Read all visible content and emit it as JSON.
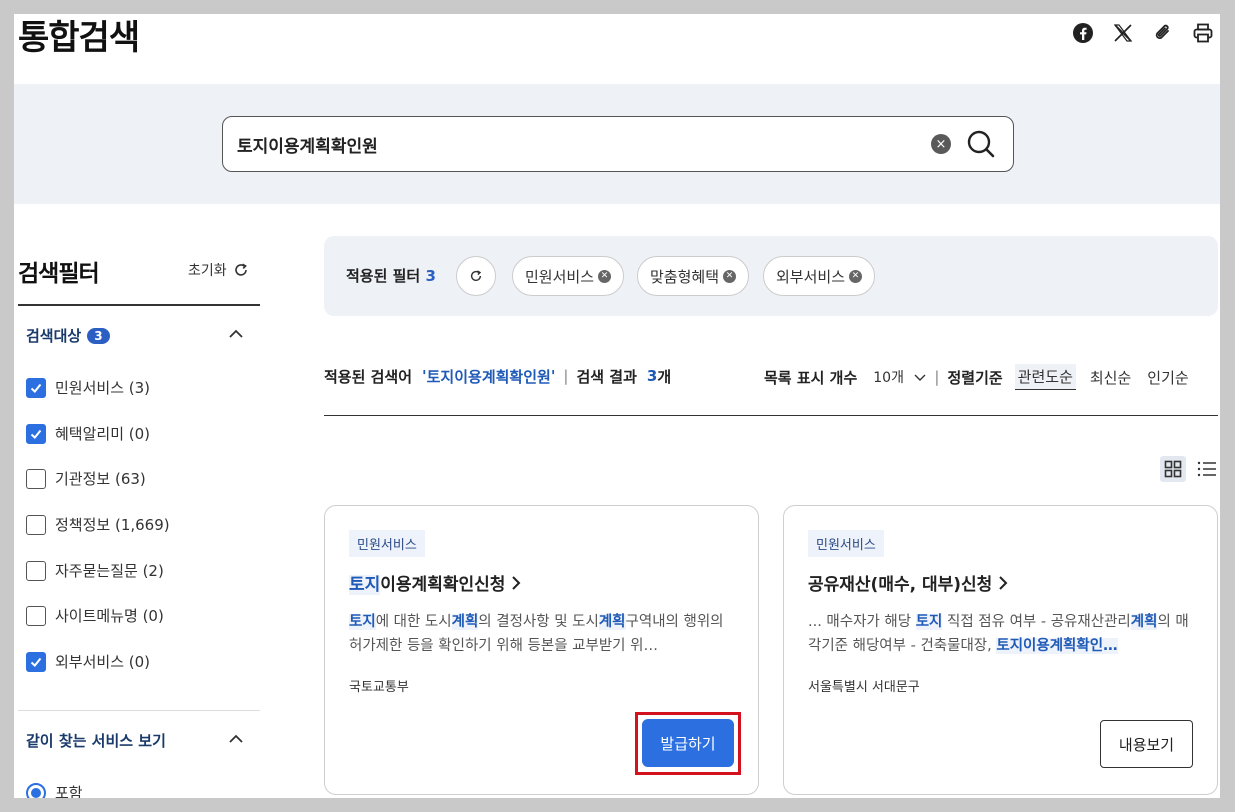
{
  "page": {
    "title": "통합검색"
  },
  "share": {
    "icons": [
      "facebook-icon",
      "x-icon",
      "attach-icon",
      "print-icon"
    ]
  },
  "search": {
    "value": "토지이용계획확인원",
    "clear": "×"
  },
  "sidebar": {
    "title": "검색필터",
    "reset_label": "초기화",
    "section1": {
      "title": "검색대상",
      "count": "3",
      "items": [
        {
          "label": "민원서비스 (3)",
          "checked": true
        },
        {
          "label": "혜택알리미 (0)",
          "checked": true
        },
        {
          "label": "기관정보 (63)",
          "checked": false
        },
        {
          "label": "정책정보 (1,669)",
          "checked": false
        },
        {
          "label": "자주묻는질문 (2)",
          "checked": false
        },
        {
          "label": "사이트메뉴명 (0)",
          "checked": false
        },
        {
          "label": "외부서비스 (0)",
          "checked": true
        }
      ]
    },
    "section2": {
      "title": "같이 찾는 서비스 보기",
      "radio_label": "포함"
    }
  },
  "applied": {
    "label": "적용된 필터",
    "count": "3",
    "chips": [
      "민원서비스",
      "맞춤형혜택",
      "외부서비스"
    ]
  },
  "summary": {
    "query_label": "적용된 검색어",
    "query_open": "'",
    "query": "토지이용계획확인원",
    "query_close": "'",
    "result_label": "검색 결과",
    "result_count": "3",
    "result_unit": "개",
    "per_page_label": "목록 표시 개수",
    "per_page_value": "10개",
    "sort_label": "정렬기준",
    "sort_options": [
      "관련도순",
      "최신순",
      "인기순"
    ]
  },
  "cards": [
    {
      "tag": "민원서비스",
      "title_hl": "토지",
      "title_rest": "이용계획확인신청",
      "desc_parts": [
        {
          "t": "토지",
          "hl": true
        },
        {
          "t": "에 대한 도시",
          "hl": false
        },
        {
          "t": "계획",
          "hl": true
        },
        {
          "t": "의 결정사항 및 도시",
          "hl": false
        },
        {
          "t": "계획",
          "hl": true
        },
        {
          "t": "구역내의 행위의 허가제한 등을 확인하기 위해 등본을 교부받기 위…",
          "hl": false
        }
      ],
      "org": "국토교통부",
      "button": "발급하기"
    },
    {
      "tag": "민원서비스",
      "title_hl": "",
      "title_rest": "공유재산(매수, 대부)신청",
      "desc_parts": [
        {
          "t": "... 매수자가 해당 ",
          "hl": false
        },
        {
          "t": "토지",
          "hl": true
        },
        {
          "t": " 직접 점유 여부 - 공유재산관리",
          "hl": false
        },
        {
          "t": "계획",
          "hl": true
        },
        {
          "t": "의 매각기준 해당여부 - 건축물대장, ",
          "hl": false
        },
        {
          "t": "토지이용계획확인…",
          "hl": true
        }
      ],
      "org": "서울특별시 서대문구",
      "button": "내용보기"
    }
  ],
  "colors": {
    "primary": "#2b6fe0",
    "highlight": "#1f5ab7",
    "band": "#eef1f6",
    "frame": "#d3121e"
  }
}
